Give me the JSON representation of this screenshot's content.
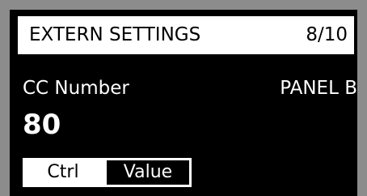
{
  "header": {
    "title": "EXTERN SETTINGS",
    "page": "8/10"
  },
  "parameter": {
    "label": "CC Number",
    "panel": "PANEL B",
    "value": "80"
  },
  "tabs": [
    {
      "label": "Ctrl",
      "selected": false
    },
    {
      "label": "Value",
      "selected": true
    }
  ],
  "colors": {
    "bezel": "#8c8c8c",
    "screen": "#000000",
    "highlight": "#ffffff"
  }
}
